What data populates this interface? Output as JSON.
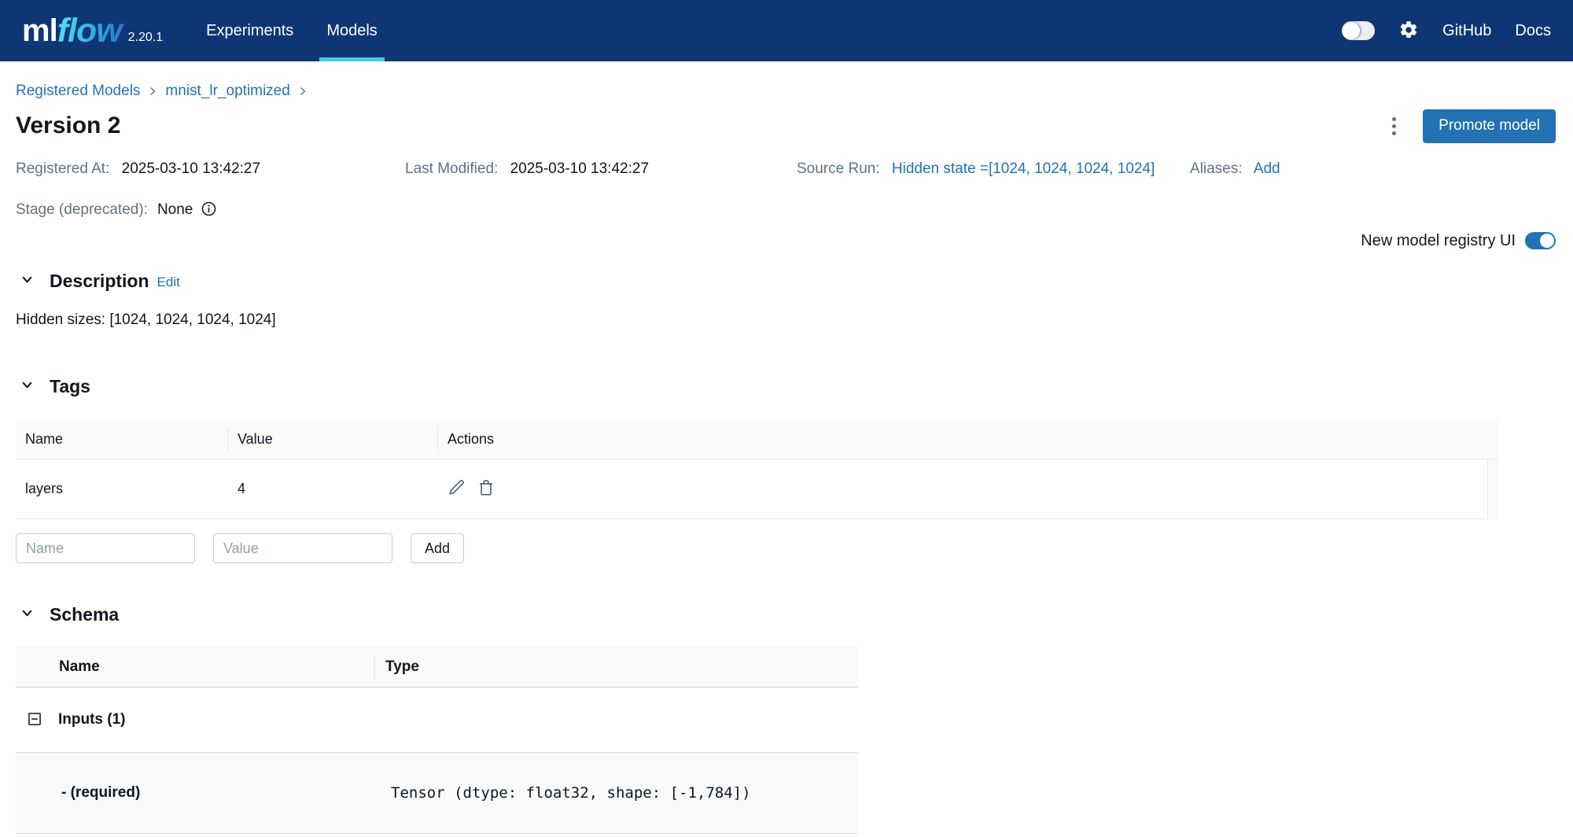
{
  "navbar": {
    "logo_ml": "ml",
    "logo_flow": "flow",
    "version": "2.20.1",
    "tabs": [
      {
        "label": "Experiments",
        "active": false
      },
      {
        "label": "Models",
        "active": true
      }
    ],
    "links": [
      "GitHub",
      "Docs"
    ]
  },
  "breadcrumb": {
    "items": [
      "Registered Models",
      "mnist_lr_optimized"
    ]
  },
  "header": {
    "title": "Version 2",
    "promote_button": "Promote model"
  },
  "metadata": {
    "registered_at_label": "Registered At:",
    "registered_at": "2025-03-10 13:42:27",
    "last_modified_label": "Last Modified:",
    "last_modified": "2025-03-10 13:42:27",
    "source_run_label": "Source Run:",
    "source_run": "Hidden state =[1024, 1024, 1024, 1024]",
    "aliases_label": "Aliases:",
    "aliases_add": "Add",
    "stage_label": "Stage (deprecated):",
    "stage_value": "None"
  },
  "registry_toggle": {
    "label": "New model registry UI",
    "on": true
  },
  "description": {
    "title": "Description",
    "edit_label": "Edit",
    "content": "Hidden sizes: [1024, 1024, 1024, 1024]"
  },
  "tags": {
    "title": "Tags",
    "columns": [
      "Name",
      "Value",
      "Actions"
    ],
    "rows": [
      {
        "name": "layers",
        "value": "4"
      }
    ],
    "name_placeholder": "Name",
    "value_placeholder": "Value",
    "add_button": "Add"
  },
  "schema": {
    "title": "Schema",
    "columns": [
      "Name",
      "Type"
    ],
    "group_label": "Inputs (1)",
    "rows": [
      {
        "name": "- (required)",
        "type": "Tensor (dtype: float32, shape: [-1,784])"
      }
    ]
  },
  "colors": {
    "navbar_bg": "#0e3675",
    "accent_blue": "#2272b4",
    "tab_underline": "#43c9ed",
    "muted_label": "#5f7281",
    "table_header_bg": "#fafafa"
  }
}
